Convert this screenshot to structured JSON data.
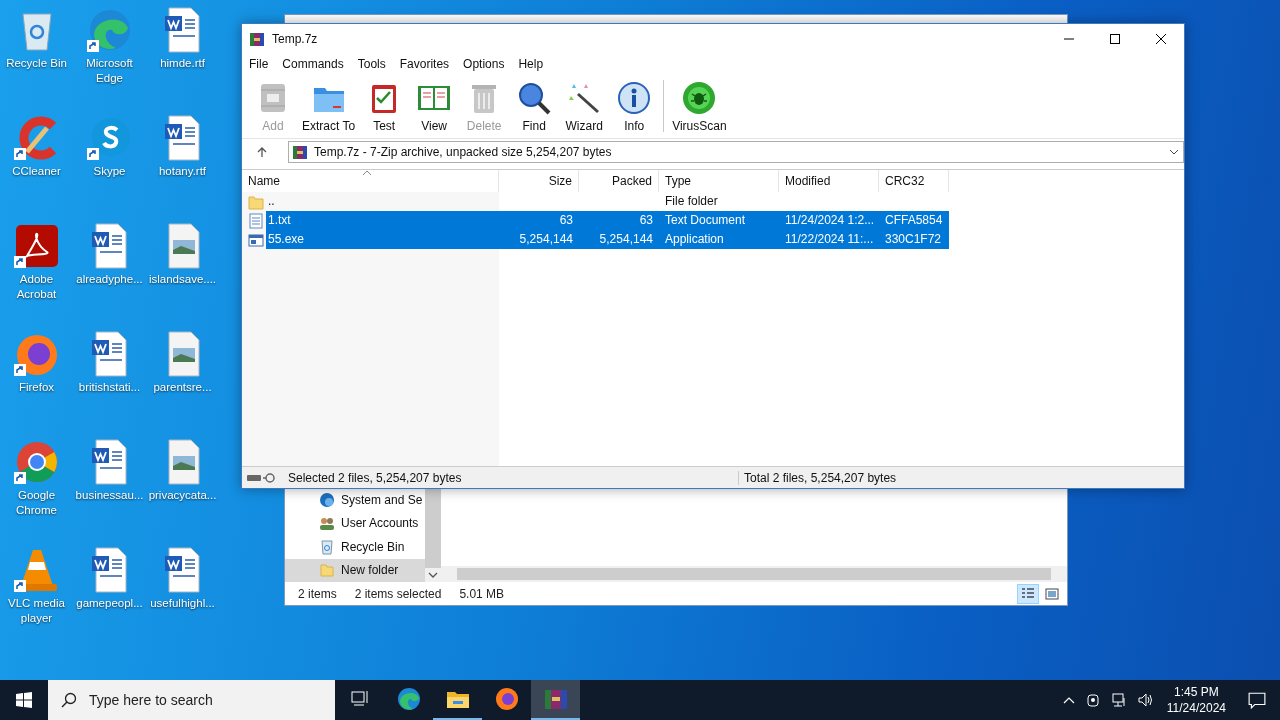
{
  "desktop": {
    "icons": [
      {
        "label": "Recycle Bin",
        "kind": "recycle",
        "shortcut": false
      },
      {
        "label": "CCleaner",
        "kind": "ccleaner",
        "shortcut": true
      },
      {
        "label": "Adobe Acrobat",
        "kind": "pdf",
        "shortcut": true
      },
      {
        "label": "Firefox",
        "kind": "firefox",
        "shortcut": true
      },
      {
        "label": "Google Chrome",
        "kind": "chrome",
        "shortcut": true
      },
      {
        "label": "VLC media player",
        "kind": "vlc",
        "shortcut": true
      },
      {
        "label": "Microsoft Edge",
        "kind": "edge",
        "shortcut": true
      },
      {
        "label": "Skype",
        "kind": "skype",
        "shortcut": true
      },
      {
        "label": "alreadyphe...",
        "kind": "word",
        "shortcut": false
      },
      {
        "label": "britishstati...",
        "kind": "word",
        "shortcut": false
      },
      {
        "label": "businessau...",
        "kind": "word",
        "shortcut": false
      },
      {
        "label": "gamepeopl...",
        "kind": "word",
        "shortcut": false
      },
      {
        "label": "himde.rtf",
        "kind": "word",
        "shortcut": false
      },
      {
        "label": "hotany.rtf",
        "kind": "word",
        "shortcut": false
      },
      {
        "label": "islandsave....",
        "kind": "image",
        "shortcut": false
      },
      {
        "label": "parentsre...",
        "kind": "image",
        "shortcut": false
      },
      {
        "label": "privacycata...",
        "kind": "image",
        "shortcut": false
      },
      {
        "label": "usefulhighl...",
        "kind": "word",
        "shortcut": false
      }
    ]
  },
  "explorer": {
    "nav_items": [
      {
        "label": "System and Se",
        "kind": "system",
        "selected": false
      },
      {
        "label": "User Accounts",
        "kind": "users",
        "selected": false
      },
      {
        "label": "Recycle Bin",
        "kind": "recycle",
        "selected": false
      },
      {
        "label": "New folder",
        "kind": "folder",
        "selected": true
      }
    ],
    "status": {
      "count": "2 items",
      "selection": "2 items selected",
      "size": "5.01 MB"
    },
    "view_modes": [
      {
        "kind": "details",
        "selected": true
      },
      {
        "kind": "tiles",
        "selected": false
      }
    ]
  },
  "archive_window": {
    "title": "Temp.7z",
    "menu": [
      "File",
      "Commands",
      "Tools",
      "Favorites",
      "Options",
      "Help"
    ],
    "toolbar_groups": [
      {
        "buttons": [
          {
            "label": "Add",
            "kind": "add",
            "disabled": true
          },
          {
            "label": "Extract To",
            "kind": "extract",
            "disabled": false
          },
          {
            "label": "Test",
            "kind": "test",
            "disabled": false
          },
          {
            "label": "View",
            "kind": "view",
            "disabled": false
          },
          {
            "label": "Delete",
            "kind": "delete",
            "disabled": true
          },
          {
            "label": "Find",
            "kind": "find",
            "disabled": false
          },
          {
            "label": "Wizard",
            "kind": "wizard",
            "disabled": false
          },
          {
            "label": "Info",
            "kind": "info",
            "disabled": false
          }
        ]
      },
      {
        "buttons": [
          {
            "label": "VirusScan",
            "kind": "virusscan",
            "disabled": false
          }
        ]
      }
    ],
    "address": "Temp.7z - 7-Zip archive, unpacked size 5,254,207 bytes",
    "columns": [
      {
        "label": "Name",
        "sorted": true
      },
      {
        "label": "Size",
        "sorted": false
      },
      {
        "label": "Packed",
        "sorted": false
      },
      {
        "label": "Type",
        "sorted": false
      },
      {
        "label": "Modified",
        "sorted": false
      },
      {
        "label": "CRC32",
        "sorted": false
      }
    ],
    "rows": [
      {
        "name": "..",
        "kind": "folder",
        "type": "File folder",
        "selected": false
      },
      {
        "name": "1.txt",
        "kind": "text",
        "size": "63",
        "packed": "63",
        "type": "Text Document",
        "modified": "11/24/2024 1:2...",
        "crc": "CFFA5854",
        "selected": true
      },
      {
        "name": "55.exe",
        "kind": "exe",
        "size": "5,254,144",
        "packed": "5,254,144",
        "type": "Application",
        "modified": "11/22/2024 11:...",
        "crc": "330C1F72",
        "selected": true
      }
    ],
    "status_left": "Selected 2 files, 5,254,207 bytes",
    "status_right": "Total 2 files, 5,254,207 bytes"
  },
  "taskbar": {
    "search_placeholder": "Type here to search",
    "apps": [
      {
        "kind": "taskview",
        "active": false,
        "running": false
      },
      {
        "kind": "edge",
        "active": false,
        "running": false
      },
      {
        "kind": "explorer",
        "active": false,
        "running": true
      },
      {
        "kind": "firefox",
        "active": false,
        "running": false
      },
      {
        "kind": "archiver",
        "active": true,
        "running": true
      }
    ],
    "time": "1:45 PM",
    "date": "11/24/2024"
  }
}
